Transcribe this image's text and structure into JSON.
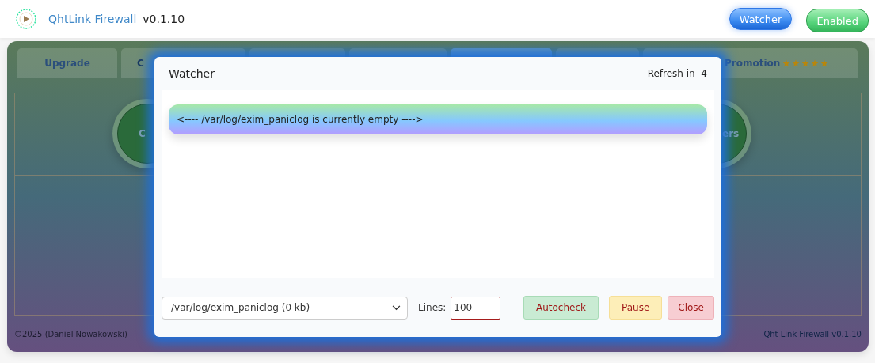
{
  "header": {
    "app_name": "QhtLink Firewall",
    "version": "v0.1.10",
    "watcher_button": "Watcher",
    "status_button": {
      "label": "Enabled",
      "on": true
    }
  },
  "tabs": [
    {
      "label": "Upgrade",
      "selected": false
    },
    {
      "label": "C",
      "selected": false
    },
    {
      "selected": false
    },
    {
      "selected": false
    },
    {
      "selected": true
    },
    {
      "selected": false
    },
    {
      "label": "Promotion",
      "stars": 5,
      "selected": false
    }
  ],
  "circle_buttons": [
    {
      "label": "C"
    },
    {
      "label": "ers"
    }
  ],
  "footer": {
    "copyright": "©2025 (Daniel Nowakowski)",
    "version": "Qht Link Firewall v0.1.10"
  },
  "modal": {
    "title": "Watcher",
    "refresh_label": "Refresh in",
    "refresh_count": "4",
    "log_lines": [
      "<---- /var/log/exim_paniclog is currently empty ---->"
    ],
    "file_select": "/var/log/exim_paniclog (0 kb)",
    "lines_label": "Lines:",
    "lines_value": "100",
    "buttons": [
      {
        "label": "Autocheck",
        "kind": "success"
      },
      {
        "label": "Pause",
        "kind": "warning"
      },
      {
        "label": "Close",
        "kind": "danger"
      }
    ]
  }
}
